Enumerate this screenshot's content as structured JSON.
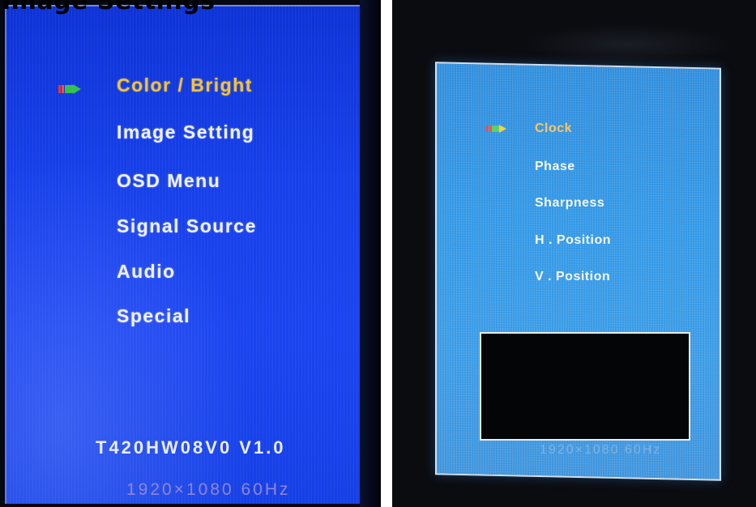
{
  "left_panel": {
    "cropped_heading": "Image Settings",
    "menu_items": [
      {
        "label": "Color / Bright",
        "selected": true
      },
      {
        "label": "Image  Setting",
        "selected": false
      },
      {
        "label": "OSD  Menu",
        "selected": false
      },
      {
        "label": "Signal  Source",
        "selected": false
      },
      {
        "label": "Audio",
        "selected": false
      },
      {
        "label": "Special",
        "selected": false
      }
    ],
    "model": "T420HW08V0  V1.0",
    "resolution": "1920×1080  60Hz"
  },
  "right_panel": {
    "menu_items": [
      {
        "label": "Clock",
        "selected": true
      },
      {
        "label": "Phase",
        "selected": false
      },
      {
        "label": "Sharpness",
        "selected": false
      },
      {
        "label": "H . Position",
        "selected": false
      },
      {
        "label": "V . Position",
        "selected": false
      }
    ],
    "resolution": "1920×1080  60Hz"
  },
  "colors": {
    "left_osd_blue": "#1740ea",
    "right_osd_blue": "#3298e6",
    "selected_text": "#f2c238",
    "normal_text": "#eef1ff"
  },
  "icons": {
    "selection_marker": "arrow-marker-icon"
  }
}
